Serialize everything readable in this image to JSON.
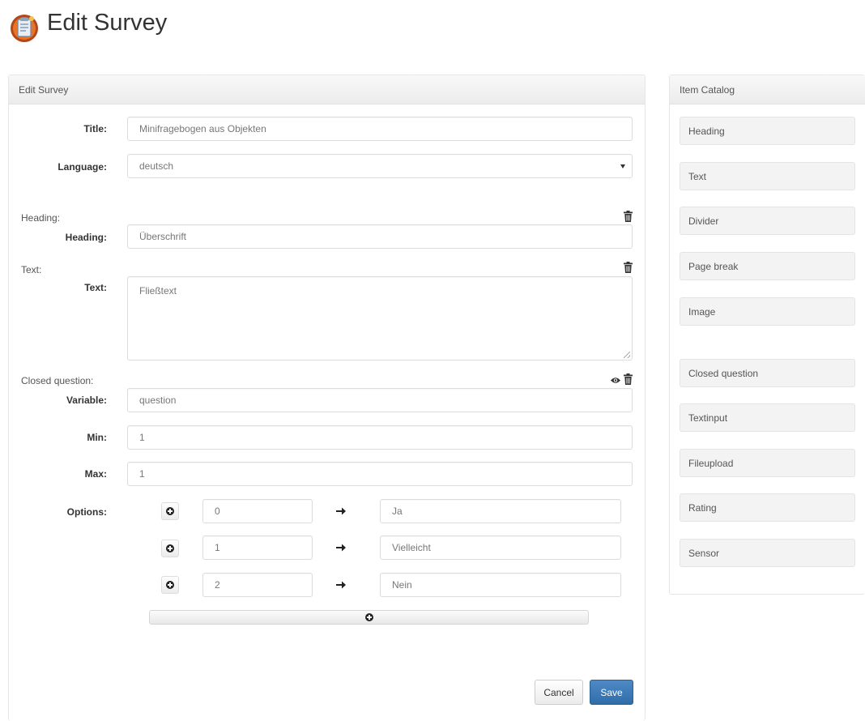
{
  "page": {
    "title": "Edit Survey"
  },
  "edit_panel": {
    "heading": "Edit Survey",
    "fields": {
      "title_label": "Title:",
      "title_value": "Minifragebogen aus Objekten",
      "language_label": "Language:",
      "language_value": "deutsch"
    },
    "items": {
      "heading_section": "Heading:",
      "heading_label": "Heading:",
      "heading_value": "Überschrift",
      "text_section": "Text:",
      "text_label": "Text:",
      "text_value": "Fließtext",
      "closed_section": "Closed question:",
      "variable_label": "Variable:",
      "variable_value": "question",
      "min_label": "Min:",
      "min_value": "1",
      "max_label": "Max:",
      "max_value": "1",
      "options_label": "Options:",
      "options": [
        {
          "value": "0",
          "label": "Ja"
        },
        {
          "value": "1",
          "label": "Vielleicht"
        },
        {
          "value": "2",
          "label": "Nein"
        }
      ]
    },
    "buttons": {
      "cancel": "Cancel",
      "save": "Save"
    }
  },
  "catalog_panel": {
    "heading": "Item Catalog",
    "items": [
      "Heading",
      "Text",
      "Divider",
      "Page break",
      "Image",
      "Closed question",
      "Textinput",
      "Fileupload",
      "Rating",
      "Sensor"
    ]
  },
  "colors": {
    "primary": "#2f6ca8",
    "panel_heading": "#ececec",
    "catalog_item": "#f3f3f3"
  },
  "icons": {
    "logo": "survey-logo-icon",
    "trash": "trash-icon",
    "eye": "eye-icon",
    "add": "plus-circle-icon",
    "arrow": "arrow-right-icon",
    "select": "chevron-down-icon"
  }
}
